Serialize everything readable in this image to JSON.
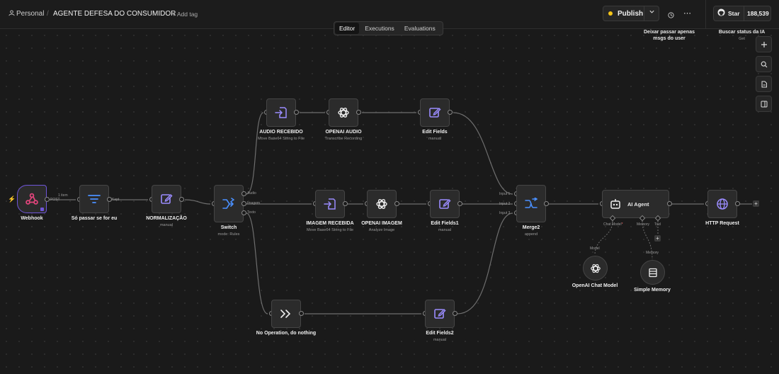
{
  "header": {
    "project_label": "Personal",
    "separator": "/",
    "workflow_name": "AGENTE DEFESA DO CONSUMIDOR",
    "add_tag": "+ Add tag",
    "publish_label": "Publish",
    "star_label": "Star",
    "star_count": "188,539"
  },
  "tabs": [
    "Editor",
    "Executions",
    "Evaluations"
  ],
  "notes": {
    "note1": "Deixar passar apenas msgs do user",
    "note2": "Buscar status da IA",
    "note2_sub": "Get"
  },
  "nodes": {
    "webhook": {
      "label": "Webhook",
      "icon": "webhook-icon",
      "accent": "#e0457b"
    },
    "filter": {
      "label": "Só passar se for eu",
      "icon": "filter-icon"
    },
    "normalizacao": {
      "label": "NORMALIZAÇÃO",
      "sub": "manual",
      "icon": "edit-icon"
    },
    "switch": {
      "label": "Switch",
      "sub": "mode: Rules",
      "icon": "switch-icon",
      "outputs": [
        "Audio",
        "Imagem",
        "Texto"
      ]
    },
    "audio_recebido": {
      "label": "AUDIO RECEBIDO",
      "sub": "Move Base64 String to File",
      "icon": "file-convert-icon"
    },
    "openai_audio": {
      "label": "OPENAI AUDIO",
      "sub": "Transcribe Recording",
      "icon": "openai-icon"
    },
    "edit_fields": {
      "label": "Edit Fields",
      "sub": "manual",
      "icon": "edit-icon"
    },
    "imagem_recebida": {
      "label": "IMAGEM RECEBIDA",
      "sub": "Move Base64 String to File",
      "icon": "file-convert-icon"
    },
    "openai_imagem": {
      "label": "OPENAI IMAGEM",
      "sub": "Analyze Image",
      "icon": "openai-icon"
    },
    "edit_fields1": {
      "label": "Edit Fields1",
      "sub": "manual",
      "icon": "edit-icon"
    },
    "noop": {
      "label": "No Operation, do nothing",
      "icon": "noop-icon"
    },
    "edit_fields2": {
      "label": "Edit Fields2",
      "sub": "manual",
      "icon": "edit-icon"
    },
    "merge2": {
      "label": "Merge2",
      "sub": "append",
      "icon": "merge-icon",
      "inputs": [
        "Input 1",
        "Input 2",
        "Input 3"
      ]
    },
    "ai_agent": {
      "label": "AI Agent",
      "icon": "robot-icon",
      "ports": [
        "Chat Model",
        "*",
        "Memory",
        "Tool"
      ]
    },
    "http_request": {
      "label": "HTTP Request",
      "icon": "globe-icon"
    },
    "openai_chat": {
      "label": "OpenAI Chat Model",
      "icon": "openai-icon",
      "port": "Model"
    },
    "simple_memory": {
      "label": "Simple Memory",
      "icon": "database-icon",
      "port": "Memory"
    }
  },
  "edges": {
    "webhook_out": "1 item",
    "webhook_port": "POST",
    "filter_port": "Kept"
  },
  "colors": {
    "node_icon": "#9b8cff",
    "webhook": "#e0457b",
    "publish_dot": "#f5c518",
    "required": "#ff6b6b"
  }
}
